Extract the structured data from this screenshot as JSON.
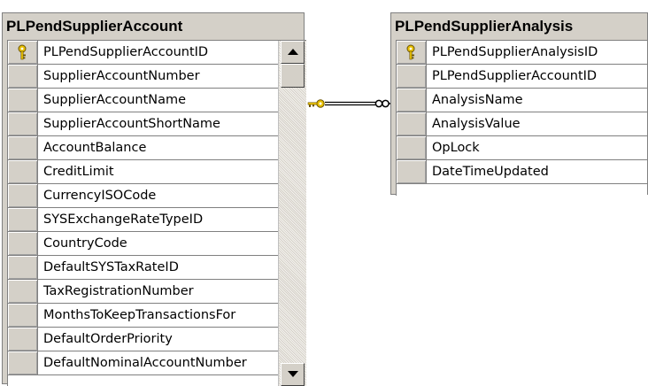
{
  "tables": {
    "account": {
      "title": "PLPendSupplierAccount",
      "columns": [
        {
          "name": "PLPendSupplierAccountID",
          "key": true
        },
        {
          "name": "SupplierAccountNumber",
          "key": false
        },
        {
          "name": "SupplierAccountName",
          "key": false
        },
        {
          "name": "SupplierAccountShortName",
          "key": false
        },
        {
          "name": "AccountBalance",
          "key": false
        },
        {
          "name": "CreditLimit",
          "key": false
        },
        {
          "name": "CurrencyISOCode",
          "key": false
        },
        {
          "name": "SYSExchangeRateTypeID",
          "key": false
        },
        {
          "name": "CountryCode",
          "key": false
        },
        {
          "name": "DefaultSYSTaxRateID",
          "key": false
        },
        {
          "name": "TaxRegistrationNumber",
          "key": false
        },
        {
          "name": "MonthsToKeepTransactionsFor",
          "key": false
        },
        {
          "name": "DefaultOrderPriority",
          "key": false
        },
        {
          "name": "DefaultNominalAccountNumber",
          "key": false
        }
      ]
    },
    "analysis": {
      "title": "PLPendSupplierAnalysis",
      "columns": [
        {
          "name": "PLPendSupplierAnalysisID",
          "key": true
        },
        {
          "name": "PLPendSupplierAccountID",
          "key": false
        },
        {
          "name": "AnalysisName",
          "key": false
        },
        {
          "name": "AnalysisValue",
          "key": false
        },
        {
          "name": "OpLock",
          "key": false
        },
        {
          "name": "DateTimeUpdated",
          "key": false
        }
      ]
    }
  },
  "colors": {
    "key_icon": "#e8c000",
    "relationship_line": "#000000",
    "panel": "#d4d0c8"
  },
  "icons": {
    "primary_key": "key-icon",
    "relationship_one_end": "key-icon",
    "relationship_many_end": "infinity-icon",
    "scroll_up": "arrow-up-icon",
    "scroll_down": "arrow-down-icon"
  }
}
